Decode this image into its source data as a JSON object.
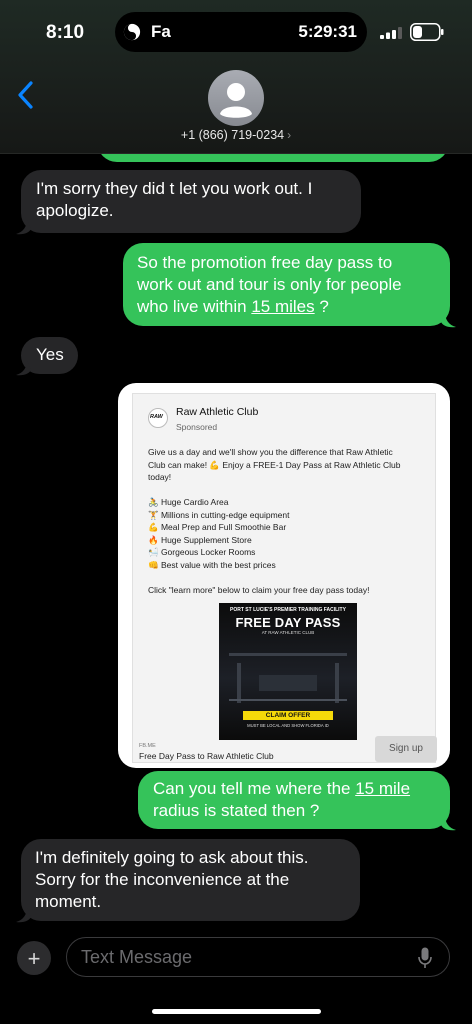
{
  "status": {
    "time": "8:10",
    "island_label": "Fa",
    "island_time": "5:29:31"
  },
  "header": {
    "contact_number": "+1 (866) 719-0234",
    "back_icon": "chevron-left-icon",
    "avatar_icon": "person-icon"
  },
  "messages": {
    "m1": "I'm sorry they did t let you work out. I apologize.",
    "m1_lines": [
      "I'm sorry they did t let you work out. I",
      "apologize."
    ],
    "m2_lines": [
      "So the promotion free day pass to",
      "work out and tour is only for people",
      "who live within "
    ],
    "m2_link": "15 miles",
    "m2_tail": " ?",
    "m3": "Yes",
    "m5_lines": [
      "Can you tell me where the "
    ],
    "m5_link": "15 mile",
    "m5_line2": "radius is stated then ?",
    "m6_lines": [
      "I'm definitely going to ask about this.",
      "Sorry for the inconvenience at the",
      "moment."
    ]
  },
  "ad": {
    "logo_text": "RAW",
    "club_name": "Raw Athletic Club",
    "sponsored": "Sponsored",
    "body_lines": [
      "Give us a day and we'll show you the difference that Raw Athletic",
      "Club can make! 💪 Enjoy a FREE-1 Day Pass at Raw Athletic Club",
      "today!",
      "",
      "🚴 Huge Cardio Area",
      "🏋 Millions in cutting-edge equipment",
      "💪 Meal Prep and Full Smoothie Bar",
      "🔥 Huge Supplement Store",
      "🛀 Gorgeous Locker Rooms",
      "👊 Best value with the best prices",
      "",
      "Click \"learn more\" below to claim your free day pass today!"
    ],
    "image": {
      "top_line": "PORT ST LUCIE'S PREMIER TRAINING FACILITY",
      "headline": "FREE DAY PASS",
      "sub": "AT RAW ATHLETIC CLUB",
      "claim": "CLAIM OFFER",
      "bottom": "MUST BE LOCAL AND SHOW FLORIDA ID"
    },
    "link_domain": "FB.ME",
    "link_title": "Free Day Pass to Raw Athletic Club",
    "cta": "Sign up"
  },
  "composer": {
    "placeholder": "Text Message",
    "plus_icon": "plus-icon",
    "mic_icon": "microphone-icon"
  },
  "colors": {
    "outgoing": "#35c35a",
    "incoming": "#262628",
    "accent": "#0a84ff"
  }
}
